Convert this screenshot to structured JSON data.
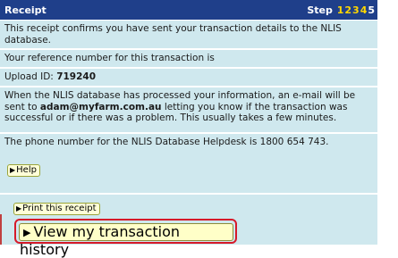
{
  "header": {
    "title": "Receipt",
    "step_label": "Step",
    "steps": [
      "1",
      "2",
      "3",
      "4",
      "5"
    ]
  },
  "rows": {
    "confirm": "This receipt confirms you have sent your transaction details to the NLIS database.",
    "reference": "Your reference number for this transaction is",
    "upload_label": "Upload ID: ",
    "upload_id": "719240",
    "email_pre": "When the NLIS database has processed your information, an e-mail will be sent to ",
    "email": "adam@myfarm.com.au",
    "email_post": " letting you know if the transaction was successful or if there was a problem. This usually takes a few minutes.",
    "helpdesk": "The phone number for the NLIS Database Helpdesk is 1800 654 743."
  },
  "buttons": {
    "help": "Help",
    "print": "Print this receipt",
    "history": "View my transaction history"
  },
  "colors": {
    "header_bg": "#1f3f8a",
    "row_bg": "#cfe8ee",
    "button_bg": "#ffffd8",
    "highlight": "#d61a2a"
  }
}
